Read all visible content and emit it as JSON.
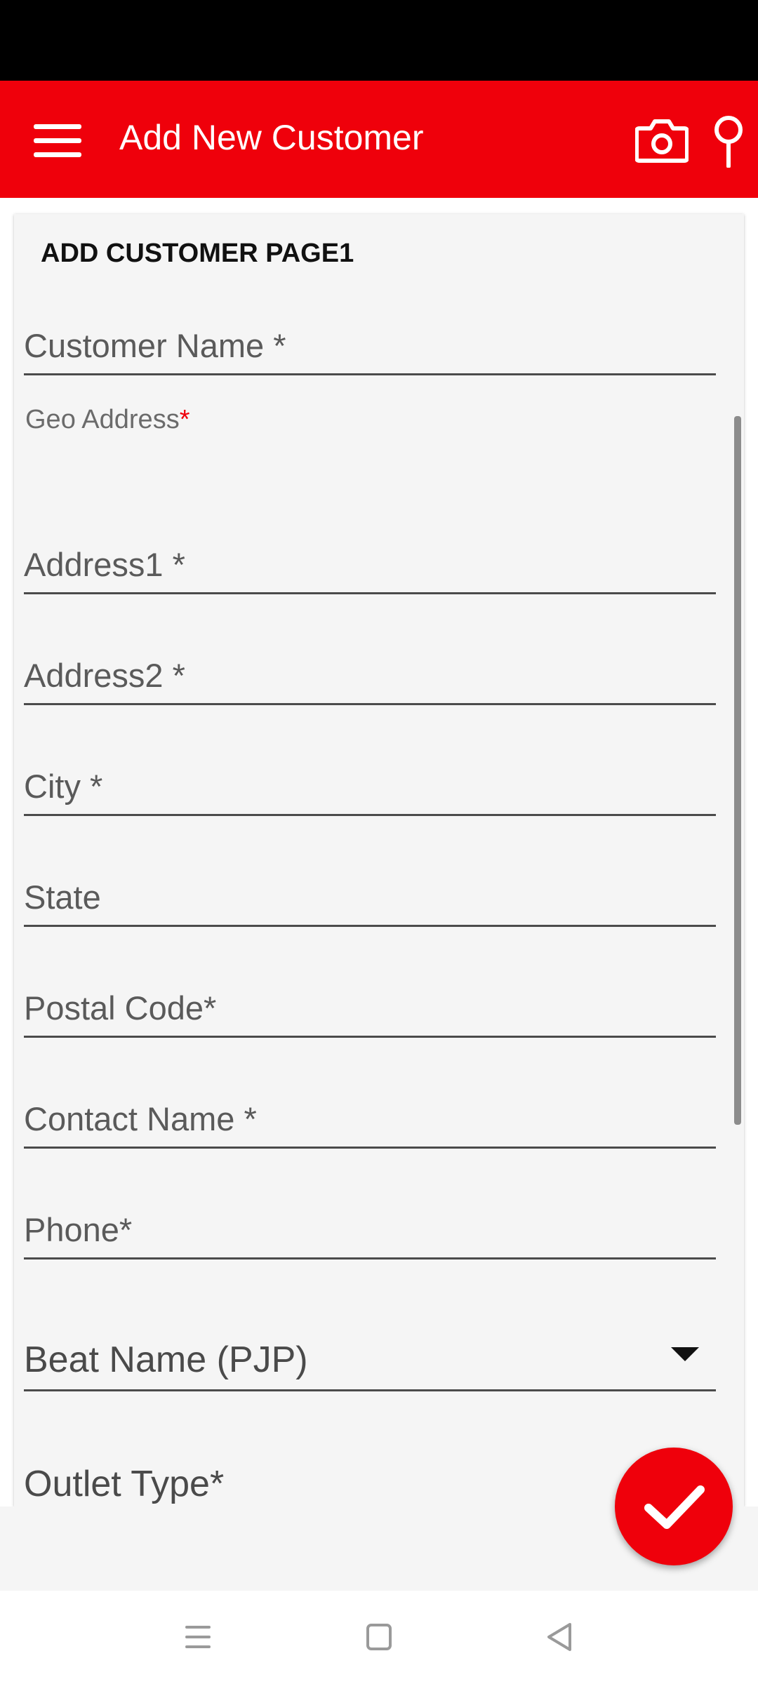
{
  "app_bar": {
    "title": "Add New Customer",
    "background_color": "#ef000b",
    "icons": [
      "menu-icon",
      "camera-icon",
      "location-pin-icon"
    ]
  },
  "form": {
    "section_title": "ADD CUSTOMER PAGE1",
    "fields": {
      "customer_name": "Customer Name *",
      "geo_address": "Geo Address",
      "geo_address_required": "*",
      "address1": "Address1  *",
      "address2": "Address2  *",
      "city": "City  *",
      "state": "State",
      "postal_code": "Postal Code*",
      "contact_name": "Contact Name *",
      "phone": "Phone*",
      "beat_name": "Beat Name (PJP)",
      "outlet_type": "Outlet Type*"
    }
  },
  "fab": {
    "icon": "checkmark-icon"
  },
  "nav_bar": {
    "icons": [
      "recent-apps-icon",
      "home-icon",
      "back-icon"
    ]
  }
}
